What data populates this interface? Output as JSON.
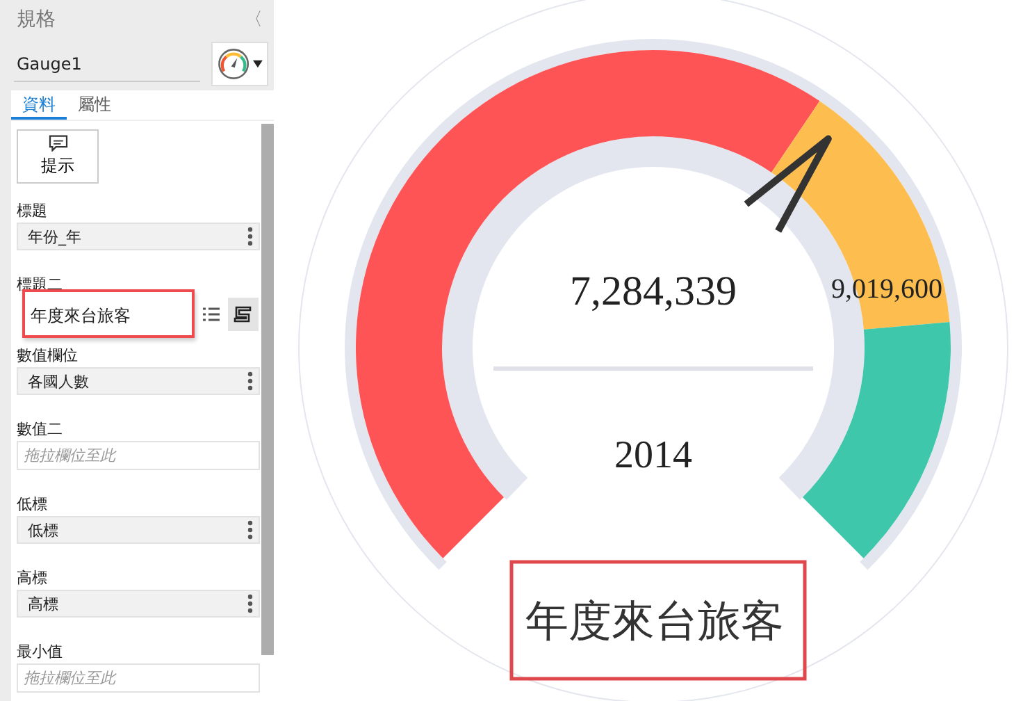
{
  "panel": {
    "title": "規格",
    "collapse": "〈",
    "name": "Gauge1",
    "tabs": [
      {
        "label": "資料",
        "selected": true
      },
      {
        "label": "屬性",
        "selected": false
      }
    ],
    "hint_button": "提示",
    "fields": [
      {
        "label": "標題",
        "kind": "select",
        "value": "年份_年"
      },
      {
        "label": "標題二",
        "kind": "text",
        "value": "年度來台旅客",
        "highlighted": true
      },
      {
        "label": "數值欄位",
        "kind": "select",
        "value": "各國人數"
      },
      {
        "label": "數值二",
        "kind": "drop",
        "placeholder": "拖拉欄位至此"
      },
      {
        "label": "低標",
        "kind": "select",
        "value": "低標"
      },
      {
        "label": "高標",
        "kind": "select",
        "value": "高標"
      },
      {
        "label": "最小值",
        "kind": "drop",
        "placeholder": "拖拉欄位至此"
      }
    ]
  },
  "gauge": {
    "value": "7,284,339",
    "target": "9,019,600",
    "label": "2014",
    "title": "年度來台旅客",
    "title_highlighted": true,
    "needle": {
      "level": 0.648
    },
    "bands": [
      {
        "color": "#fe5455"
      },
      {
        "color": "#fdbe4f"
      },
      {
        "color": "#3fc7ab"
      }
    ]
  }
}
